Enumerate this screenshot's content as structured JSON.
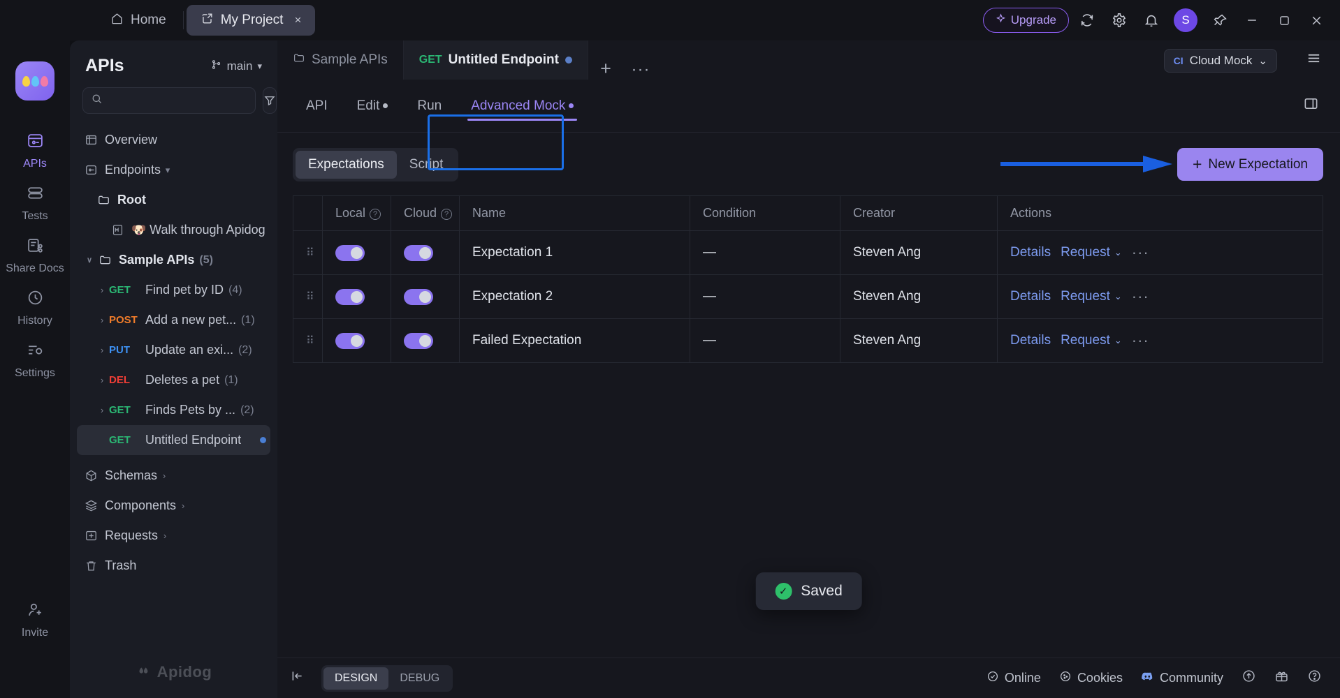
{
  "titlebar": {
    "tabs": [
      {
        "label": "Home",
        "icon": "home-icon",
        "active": false
      },
      {
        "label": "My Project",
        "icon": "project-icon",
        "active": true,
        "close": "×"
      }
    ],
    "upgrade_label": "Upgrade",
    "icons": [
      "sync-icon",
      "gear-icon",
      "bell-icon"
    ],
    "avatar_initial": "S",
    "window_controls": [
      "pin-icon",
      "minimize-icon",
      "maximize-icon",
      "close-icon"
    ]
  },
  "rail": {
    "logo_name": "apidog-logo",
    "items": [
      {
        "label": "APIs",
        "icon": "apis-icon",
        "active": true
      },
      {
        "label": "Tests",
        "icon": "tests-icon",
        "active": false
      },
      {
        "label": "Share Docs",
        "icon": "share-docs-icon",
        "active": false
      },
      {
        "label": "History",
        "icon": "history-icon",
        "active": false
      },
      {
        "label": "Settings",
        "icon": "settings-icon",
        "active": false
      }
    ],
    "bottom": {
      "label": "Invite",
      "icon": "invite-icon"
    }
  },
  "sidebar": {
    "title": "APIs",
    "branch": "main",
    "search_placeholder": "",
    "filter_icon": "filter-icon",
    "add_label": "+",
    "footer_brand": "Apidog",
    "tree": [
      {
        "type": "section",
        "label": "Overview",
        "icon": "overview-icon"
      },
      {
        "type": "section",
        "label": "Endpoints",
        "icon": "endpoints-icon",
        "caret": "▾"
      },
      {
        "type": "folder",
        "label": "Root",
        "icon": "folder-icon",
        "indent": 1
      },
      {
        "type": "doc",
        "label": "Walk through Apidog",
        "icon": "markdown-icon",
        "emoji": "🐶",
        "indent": 2
      },
      {
        "type": "folder",
        "label": "Sample APIs",
        "icon": "folder-icon",
        "count": "(5)",
        "indent": 1,
        "caret": "∨"
      },
      {
        "type": "endpoint",
        "method": "GET",
        "label": "Find pet by ID",
        "count": "(4)",
        "indent": 2,
        "caret": "›"
      },
      {
        "type": "endpoint",
        "method": "POST",
        "label": "Add a new pet...",
        "count": "(1)",
        "indent": 2,
        "caret": "›"
      },
      {
        "type": "endpoint",
        "method": "PUT",
        "label": "Update an exi...",
        "count": "(2)",
        "indent": 2,
        "caret": "›"
      },
      {
        "type": "endpoint",
        "method": "DEL",
        "label": "Deletes a pet",
        "count": "(1)",
        "indent": 2,
        "caret": "›"
      },
      {
        "type": "endpoint",
        "method": "GET",
        "label": "Finds Pets by ...",
        "count": "(2)",
        "indent": 2,
        "caret": "›"
      },
      {
        "type": "endpoint",
        "method": "GET",
        "label": "Untitled Endpoint",
        "indent": 2,
        "selected": true,
        "dot": true
      },
      {
        "type": "section",
        "label": "Schemas",
        "icon": "schemas-icon",
        "caret": "›"
      },
      {
        "type": "section",
        "label": "Components",
        "icon": "components-icon",
        "caret": "›"
      },
      {
        "type": "section",
        "label": "Requests",
        "icon": "requests-icon",
        "caret": "›"
      },
      {
        "type": "section",
        "label": "Trash",
        "icon": "trash-icon"
      }
    ]
  },
  "editor": {
    "tabs": [
      {
        "label": "Sample APIs",
        "icon": "folder-icon",
        "active": false
      },
      {
        "method": "GET",
        "label": "Untitled Endpoint",
        "active": true,
        "dot": true
      }
    ],
    "add_tab": "+",
    "more_tabs": "···",
    "mock_env": {
      "prefix": "CI",
      "label": "Cloud Mock",
      "caret": "⌄"
    },
    "menu_icon": "hamburger-icon",
    "subtabs": [
      {
        "label": "API",
        "active": false,
        "dot": false
      },
      {
        "label": "Edit",
        "active": false,
        "dot": true
      },
      {
        "label": "Run",
        "active": false,
        "dot": false
      },
      {
        "label": "Advanced Mock",
        "active": true,
        "dot": true
      }
    ],
    "panel_toggle_icon": "panel-toggle-icon"
  },
  "content": {
    "segments": [
      {
        "label": "Expectations",
        "active": true
      },
      {
        "label": "Script",
        "active": false
      }
    ],
    "new_expectation_label": "New Expectation",
    "new_expectation_plus": "+",
    "table": {
      "columns": [
        "",
        "Local",
        "Cloud",
        "Name",
        "Condition",
        "Creator",
        "Actions"
      ],
      "help_columns": [
        "Local",
        "Cloud"
      ],
      "rows": [
        {
          "local": true,
          "cloud": true,
          "name": "Expectation 1",
          "condition": "—",
          "creator": "Steven Ang",
          "actions": {
            "details": "Details",
            "request": "Request",
            "caret": "⌄",
            "more": "···"
          }
        },
        {
          "local": true,
          "cloud": true,
          "name": "Expectation 2",
          "condition": "—",
          "creator": "Steven Ang",
          "actions": {
            "details": "Details",
            "request": "Request",
            "caret": "⌄",
            "more": "···"
          }
        },
        {
          "local": true,
          "cloud": true,
          "name": "Failed Expectation",
          "condition": "—",
          "creator": "Steven Ang",
          "actions": {
            "details": "Details",
            "request": "Request",
            "caret": "⌄",
            "more": "···"
          }
        }
      ]
    },
    "toast": {
      "text": "Saved",
      "icon": "check-circle-icon"
    }
  },
  "statusbar": {
    "collapse_icon": "collapse-panel-icon",
    "modes": [
      {
        "label": "DESIGN",
        "active": true
      },
      {
        "label": "DEBUG",
        "active": false
      }
    ],
    "right_items": [
      {
        "label": "Online",
        "icon": "status-online-icon"
      },
      {
        "label": "Cookies",
        "icon": "cookies-icon"
      },
      {
        "label": "Community",
        "icon": "community-icon"
      }
    ],
    "right_icons": [
      "upload-icon",
      "gift-icon",
      "help-icon"
    ]
  },
  "annotations": {
    "tab_highlight_color": "#1a6fe8",
    "arrow_color": "#1a5fe0"
  }
}
